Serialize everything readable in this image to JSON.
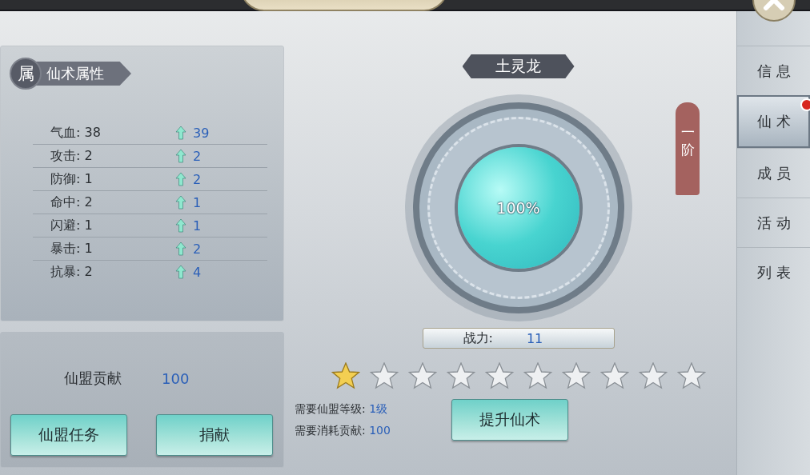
{
  "attributes": {
    "badge": "属",
    "title": "仙术属性",
    "rows": [
      {
        "label": "气血: 38",
        "next": "39"
      },
      {
        "label": "攻击: 2",
        "next": "2"
      },
      {
        "label": "防御: 1",
        "next": "2"
      },
      {
        "label": "命中: 2",
        "next": "1"
      },
      {
        "label": "闪避: 1",
        "next": "1"
      },
      {
        "label": "暴击: 1",
        "next": "2"
      },
      {
        "label": "抗暴: 2",
        "next": "4"
      }
    ]
  },
  "contribution": {
    "label": "仙盟贡献",
    "value": "100",
    "buttons": [
      "仙盟任务",
      "捐献"
    ]
  },
  "skill": {
    "name": "土灵龙",
    "level": 1,
    "progress": "100%",
    "stage": "一阶",
    "power_label": "战力:",
    "power": "11",
    "stars": 1,
    "requirements": [
      {
        "label": "需要仙盟等级:",
        "value": "1级"
      },
      {
        "label": "需要消耗贡献:",
        "value": "100"
      }
    ],
    "upgrade_button": "提升仙术"
  },
  "sidebar": {
    "tabs": [
      {
        "label": "信息",
        "selected": false,
        "alert": false
      },
      {
        "label": "仙术",
        "selected": true,
        "alert": true
      },
      {
        "label": "成员",
        "selected": false,
        "alert": false
      },
      {
        "label": "活动",
        "selected": false,
        "alert": false
      },
      {
        "label": "列表",
        "selected": false,
        "alert": false
      }
    ]
  }
}
